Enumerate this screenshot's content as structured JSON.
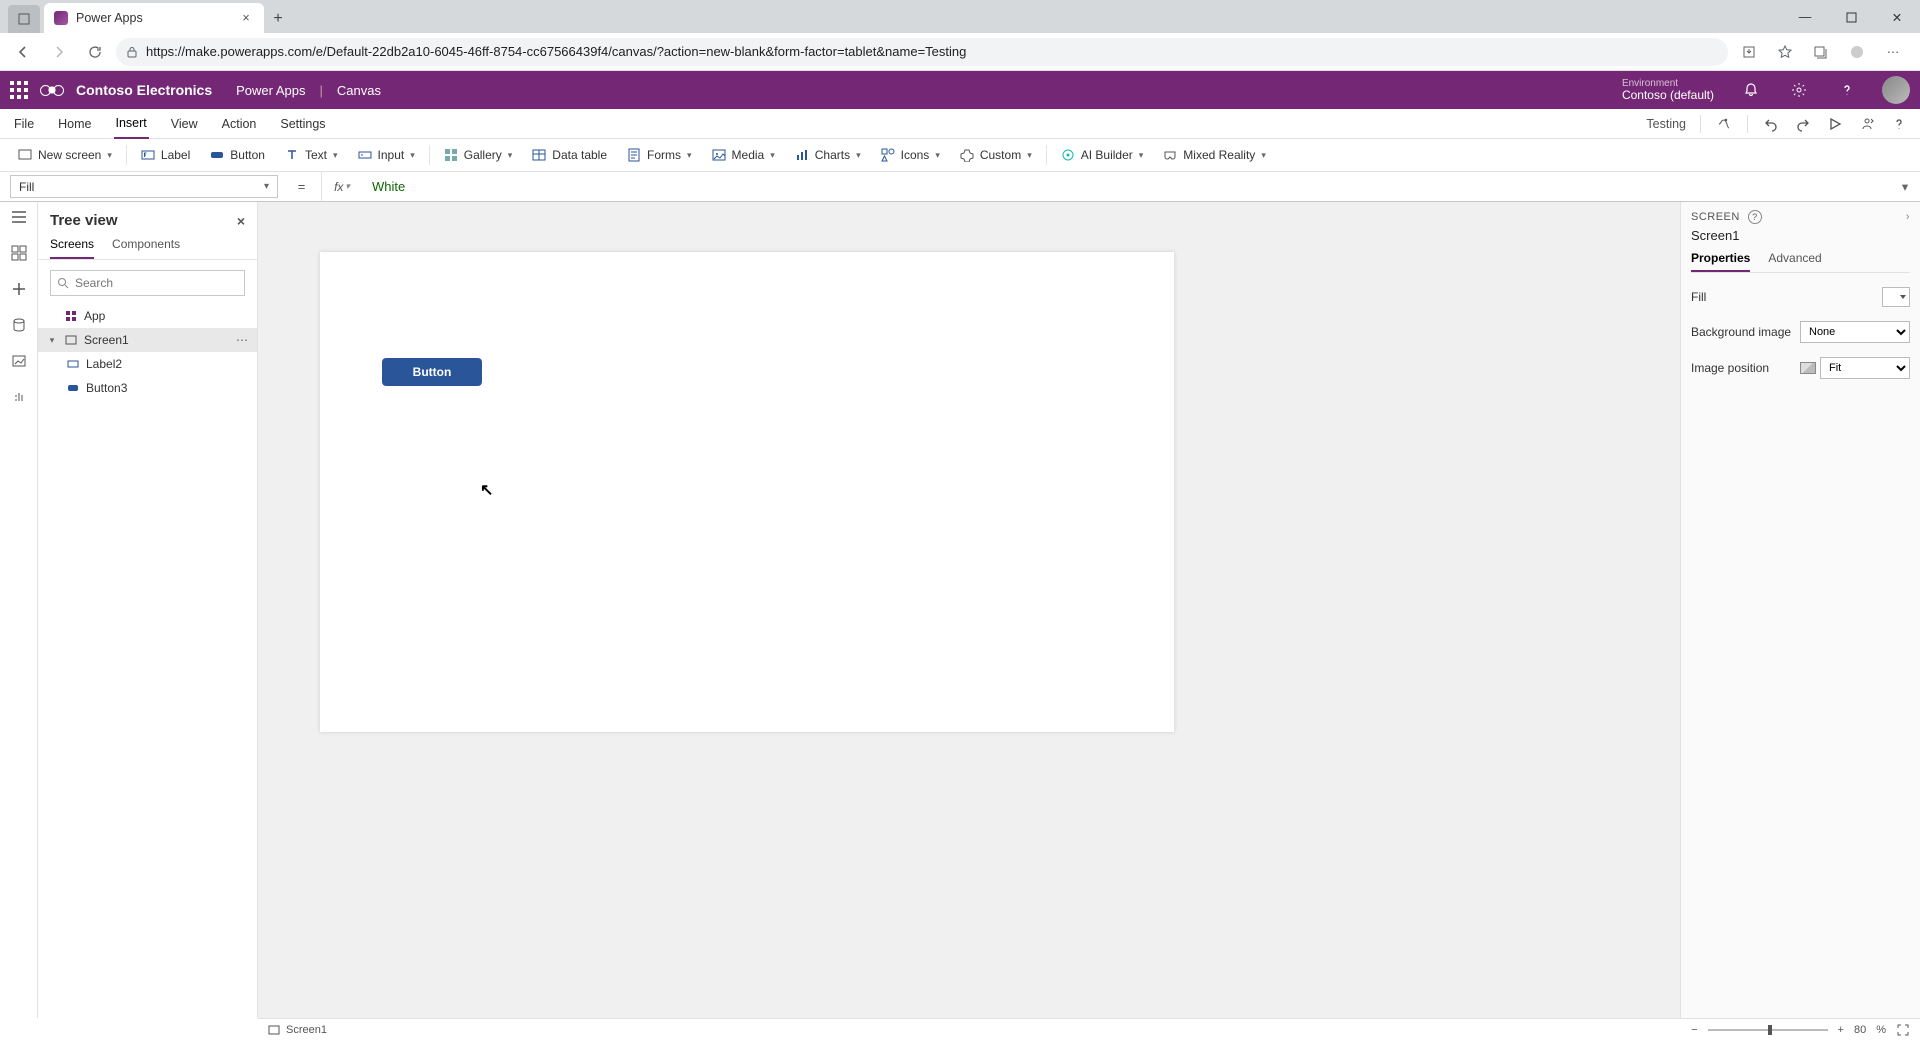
{
  "browser": {
    "tab_title": "Power Apps",
    "url": "https://make.powerapps.com/e/Default-22db2a10-6045-46ff-8754-cc67566439f4/canvas/?action=new-blank&form-factor=tablet&name=Testing"
  },
  "header": {
    "brand": "Contoso Electronics",
    "product": "Power Apps",
    "sep": "|",
    "mode": "Canvas",
    "env_label": "Environment",
    "env_name": "Contoso (default)"
  },
  "ribbon": {
    "tabs": {
      "file": "File",
      "home": "Home",
      "insert": "Insert",
      "view": "View",
      "action": "Action",
      "settings": "Settings"
    },
    "app_name": "Testing"
  },
  "insert": {
    "new_screen": "New screen",
    "label": "Label",
    "button": "Button",
    "text": "Text",
    "input": "Input",
    "gallery": "Gallery",
    "data_table": "Data table",
    "forms": "Forms",
    "media": "Media",
    "charts": "Charts",
    "icons": "Icons",
    "custom": "Custom",
    "ai_builder": "AI Builder",
    "mixed_reality": "Mixed Reality"
  },
  "formula": {
    "property": "Fill",
    "value": "White"
  },
  "tree": {
    "title": "Tree view",
    "tabs": {
      "screens": "Screens",
      "components": "Components"
    },
    "search_placeholder": "Search",
    "items": {
      "app": "App",
      "screen1": "Screen1",
      "label2": "Label2",
      "button3": "Button3"
    }
  },
  "canvas": {
    "button_text": "Button"
  },
  "props": {
    "section": "SCREEN",
    "name": "Screen1",
    "tabs": {
      "properties": "Properties",
      "advanced": "Advanced"
    },
    "fill": "Fill",
    "bg_image": "Background image",
    "bg_image_val": "None",
    "img_pos": "Image position",
    "img_pos_val": "Fit"
  },
  "status": {
    "screen": "Screen1",
    "zoom": "80",
    "pct": "%"
  }
}
